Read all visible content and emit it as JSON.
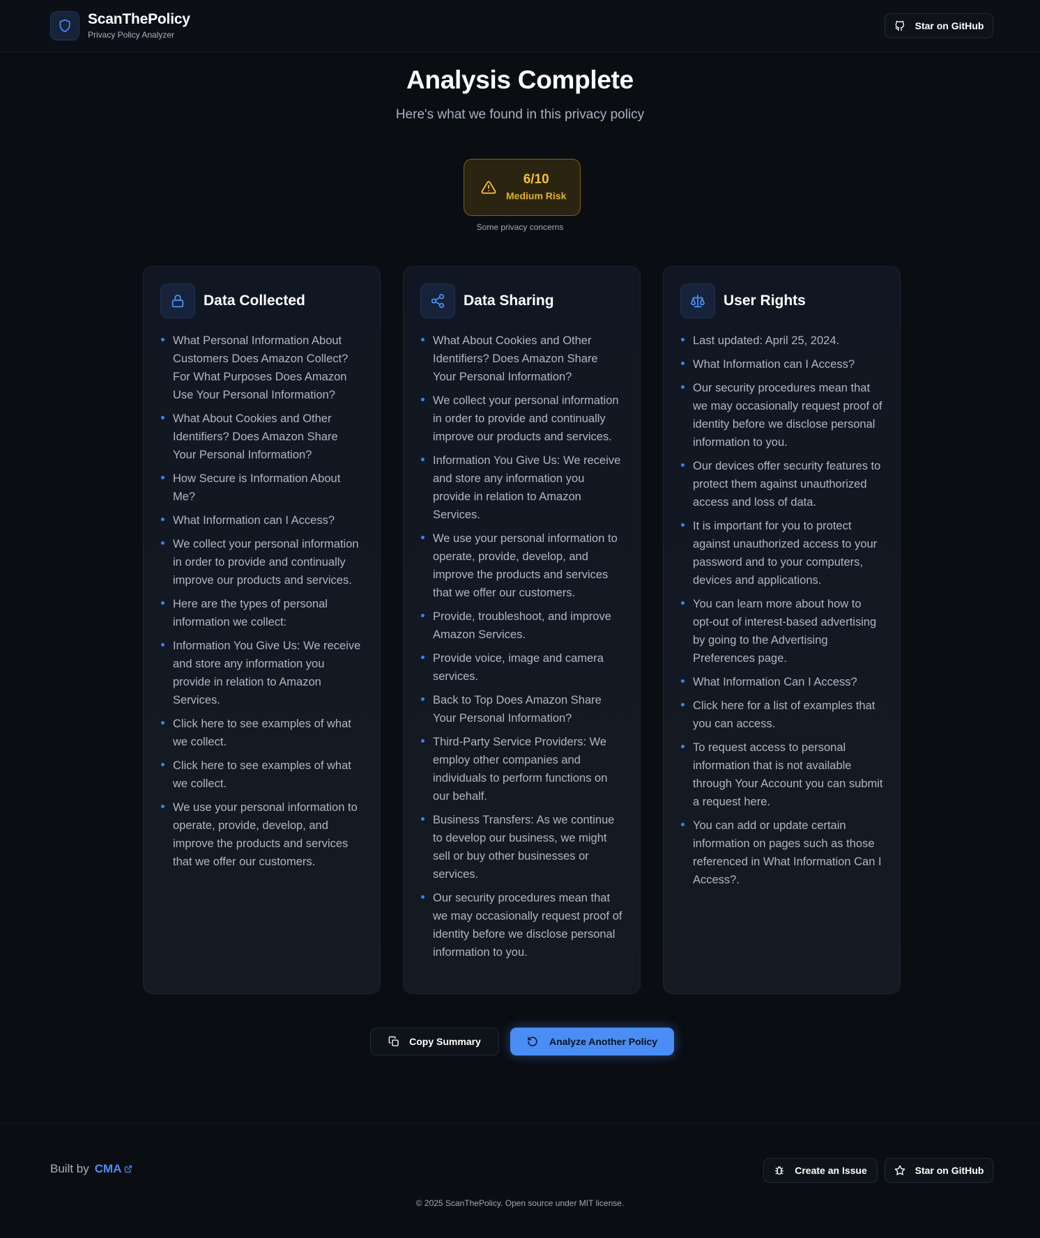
{
  "header": {
    "brand_title": "ScanThePolicy",
    "brand_subtitle": "Privacy Policy Analyzer",
    "github_label": "Star on GitHub"
  },
  "hero": {
    "title": "Analysis Complete",
    "subtitle": "Here's what we found in this privacy policy"
  },
  "risk": {
    "score": "6/10",
    "level": "Medium Risk",
    "note": "Some privacy concerns",
    "color": "#f5c230"
  },
  "cards": [
    {
      "title": "Data Collected",
      "icon": "lock-icon",
      "items": [
        "What Personal Information About Customers Does Amazon Collect? For What Purposes Does Amazon Use Your Personal Information?",
        "What About Cookies and Other Identifiers? Does Amazon Share Your Personal Information?",
        "How Secure is Information About Me?",
        "What Information can I Access?",
        "We collect your personal information in order to provide and continually improve our products and services.",
        "Here are the types of personal information we collect:",
        "Information You Give Us: We receive and store any information you provide in relation to Amazon Services.",
        "Click here to see examples of what we collect.",
        "Click here to see examples of what we collect.",
        "We use your personal information to operate, provide, develop, and improve the products and services that we offer our customers."
      ]
    },
    {
      "title": "Data Sharing",
      "icon": "share-icon",
      "items": [
        "What About Cookies and Other Identifiers? Does Amazon Share Your Personal Information?",
        "We collect your personal information in order to provide and continually improve our products and services.",
        "Information You Give Us: We receive and store any information you provide in relation to Amazon Services.",
        "We use your personal information to operate, provide, develop, and improve the products and services that we offer our customers.",
        "Provide, troubleshoot, and improve Amazon Services.",
        "Provide voice, image and camera services.",
        "Back to Top Does Amazon Share Your Personal Information?",
        "Third-Party Service Providers: We employ other companies and individuals to perform functions on our behalf.",
        "Business Transfers: As we continue to develop our business, we might sell or buy other businesses or services.",
        "Our security procedures mean that we may occasionally request proof of identity before we disclose personal information to you."
      ]
    },
    {
      "title": "User Rights",
      "icon": "scale-icon",
      "items": [
        "Last updated: April 25, 2024.",
        "What Information can I Access?",
        "Our security procedures mean that we may occasionally request proof of identity before we disclose personal information to you.",
        "Our devices offer security features to protect them against unauthorized access and loss of data.",
        "It is important for you to protect against unauthorized access to your password and to your computers, devices and applications.",
        "You can learn more about how to opt-out of interest-based advertising by going to the Advertising Preferences page.",
        "What Information Can I Access?",
        "Click here for a list of examples that you can access.",
        "To request access to personal information that is not available through Your Account you can submit a request here.",
        "You can add or update certain information on pages such as those referenced in What Information Can I Access?."
      ]
    }
  ],
  "actions": {
    "copy_label": "Copy Summary",
    "analyze_label": "Analyze Another Policy",
    "accent": "#4a8ef5"
  },
  "footer": {
    "built_by": "Built by",
    "author": "CMA",
    "issue_label": "Create an Issue",
    "github_label": "Star on GitHub",
    "copyright": "© 2025 ScanThePolicy. Open source under MIT license."
  }
}
